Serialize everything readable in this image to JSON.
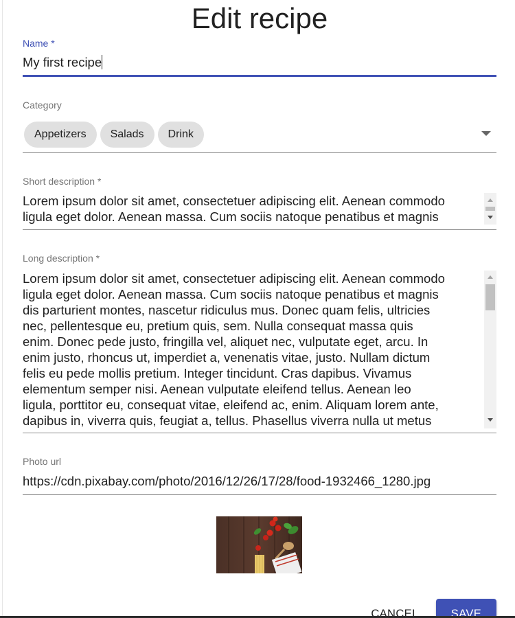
{
  "form": {
    "title": "Edit recipe",
    "name": {
      "label": "Name *",
      "value": "My first recipe"
    },
    "category": {
      "label": "Category",
      "chips": [
        "Appetizers",
        "Salads",
        "Drink"
      ]
    },
    "short_description": {
      "label": "Short description *",
      "lines": [
        "Lorem ipsum dolor sit amet, consectetuer adipiscing elit. Aenean commodo",
        "ligula eget dolor. Aenean massa. Cum sociis natoque penatibus et magnis"
      ]
    },
    "long_description": {
      "label": "Long description *",
      "lines": [
        "Lorem ipsum dolor sit amet, consectetuer adipiscing elit. Aenean commodo",
        "ligula eget dolor. Aenean massa. Cum sociis natoque penatibus et magnis",
        "dis parturient montes, nascetur ridiculus mus. Donec quam felis, ultricies",
        "nec, pellentesque eu, pretium quis, sem. Nulla consequat massa quis",
        "enim. Donec pede justo, fringilla vel, aliquet nec, vulputate eget, arcu. In",
        "enim justo, rhoncus ut, imperdiet a, venenatis vitae, justo. Nullam dictum",
        "felis eu pede mollis pretium. Integer tincidunt. Cras dapibus. Vivamus",
        "elementum semper nisi. Aenean vulputate eleifend tellus. Aenean leo",
        "ligula, porttitor eu, consequat vitae, eleifend ac, enim. Aliquam lorem ante,",
        "dapibus in, viverra quis, feugiat a, tellus. Phasellus viverra nulla ut metus"
      ]
    },
    "photo_url": {
      "label": "Photo url",
      "value": "https://cdn.pixabay.com/photo/2016/12/26/17/28/food-1932466_1280.jpg"
    }
  },
  "actions": {
    "cancel_label": "CANCEL",
    "save_label": "SAVE"
  },
  "colors": {
    "accent": "#3f51b5",
    "chip_bg": "#e0e0e0",
    "label": "#757575"
  },
  "icons": {
    "category_dropdown": "chevron-down-icon",
    "scroll_up": "scroll-up-icon",
    "scroll_down": "scroll-down-icon"
  }
}
